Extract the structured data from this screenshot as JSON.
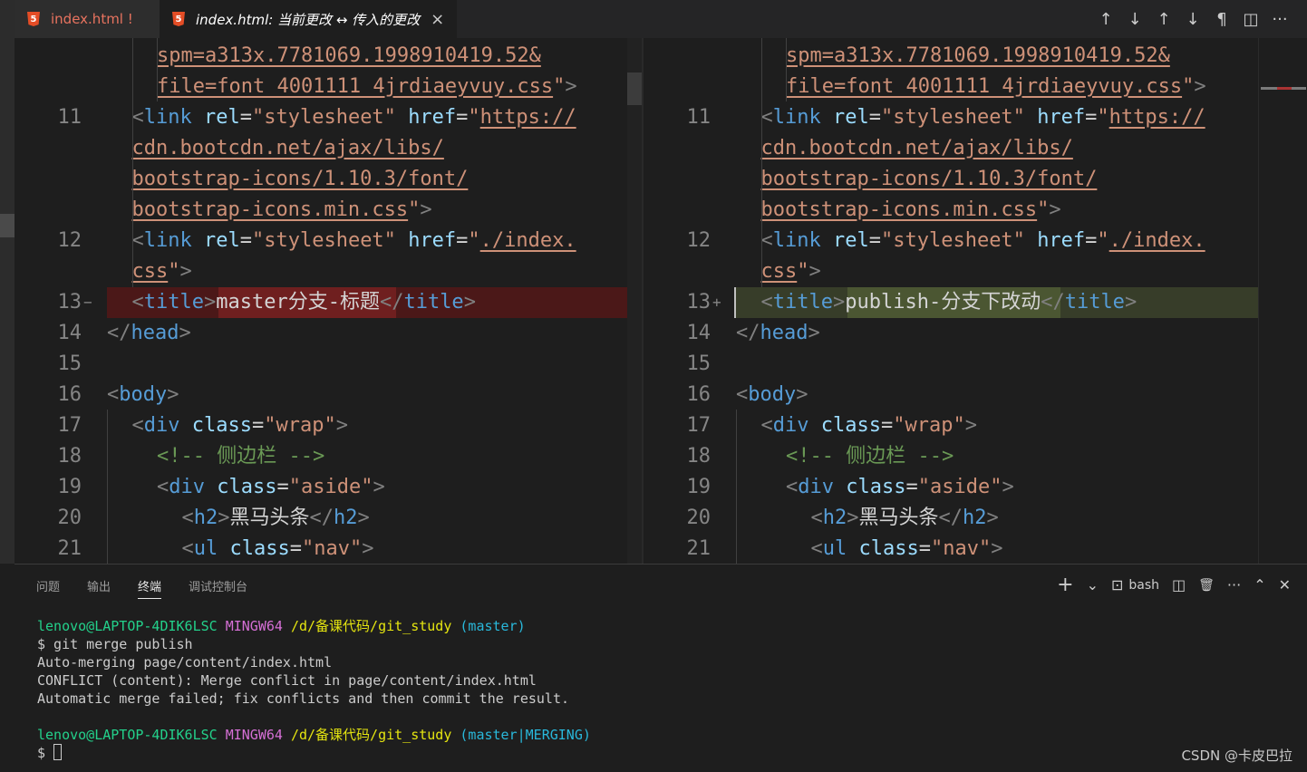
{
  "tabs": [
    {
      "label": "index.html !",
      "active": false
    },
    {
      "label": "index.html: 当前更改 ↔ 传入的更改",
      "active": true
    }
  ],
  "tab_actions": [
    "↑",
    "↓",
    "↑",
    "↓",
    "¶",
    "◫",
    "···"
  ],
  "editor": {
    "left": {
      "conflict_marker": "−",
      "lines": [
        {
          "num": "",
          "text": "spm=a313x.7781069.1998910419.52&"
        },
        {
          "num": "",
          "text": "file=font_4001111_4jrdiaeyvuy.css\">"
        },
        {
          "num": "11",
          "text": "<link rel=\"stylesheet\" href=\"https://"
        },
        {
          "num": "",
          "text": "cdn.bootcdn.net/ajax/libs/"
        },
        {
          "num": "",
          "text": "bootstrap-icons/1.10.3/font/"
        },
        {
          "num": "",
          "text": "bootstrap-icons.min.css\">"
        },
        {
          "num": "12",
          "text": "<link rel=\"stylesheet\" href=\"./index."
        },
        {
          "num": "",
          "text": "css\">"
        },
        {
          "num": "13",
          "text": "<title>master分支-标题</title>"
        },
        {
          "num": "14",
          "text": "</head>"
        },
        {
          "num": "15",
          "text": ""
        },
        {
          "num": "16",
          "text": "<body>"
        },
        {
          "num": "17",
          "text": "<div class=\"wrap\">"
        },
        {
          "num": "18",
          "text": "<!-- 侧边栏 -->"
        },
        {
          "num": "19",
          "text": "<div class=\"aside\">"
        },
        {
          "num": "20",
          "text": "<h2>黑马头条</h2>"
        },
        {
          "num": "21",
          "text": "<ul class=\"nav\">"
        }
      ]
    },
    "right": {
      "conflict_marker": "+",
      "lines": [
        {
          "num": "",
          "text": "spm=a313x.7781069.1998910419.52&"
        },
        {
          "num": "",
          "text": "file=font_4001111_4jrdiaeyvuy.css\">"
        },
        {
          "num": "11",
          "text": "<link rel=\"stylesheet\" href=\"https://"
        },
        {
          "num": "",
          "text": "cdn.bootcdn.net/ajax/libs/"
        },
        {
          "num": "",
          "text": "bootstrap-icons/1.10.3/font/"
        },
        {
          "num": "",
          "text": "bootstrap-icons.min.css\">"
        },
        {
          "num": "12",
          "text": "<link rel=\"stylesheet\" href=\"./index."
        },
        {
          "num": "",
          "text": "css\">"
        },
        {
          "num": "13",
          "text": "<title>publish-分支下改动</title>"
        },
        {
          "num": "14",
          "text": "</head>"
        },
        {
          "num": "15",
          "text": ""
        },
        {
          "num": "16",
          "text": "<body>"
        },
        {
          "num": "17",
          "text": "<div class=\"wrap\">"
        },
        {
          "num": "18",
          "text": "<!-- 侧边栏 -->"
        },
        {
          "num": "19",
          "text": "<div class=\"aside\">"
        },
        {
          "num": "20",
          "text": "<h2>黑马头条</h2>"
        },
        {
          "num": "21",
          "text": "<ul class=\"nav\">"
        }
      ]
    }
  },
  "panel": {
    "tabs": [
      {
        "label": "问题",
        "active": false
      },
      {
        "label": "输出",
        "active": false
      },
      {
        "label": "终端",
        "active": true
      },
      {
        "label": "调试控制台",
        "active": false
      }
    ],
    "actions": {
      "new": "+",
      "dropdown": "⌄",
      "shell_icon": "⊡",
      "shell": "bash",
      "split": "◫",
      "trash": "🗑",
      "more": "···",
      "maximize": "⌃",
      "close": "✕"
    }
  },
  "terminal": {
    "prompt1": {
      "user": "lenovo@LAPTOP-4DIK6LSC",
      "sys": "MINGW64",
      "path": "/d/备课代码/git_study",
      "branch": "(master)"
    },
    "command": "$ git merge publish",
    "output": [
      "Auto-merging page/content/index.html",
      "CONFLICT (content): Merge conflict in page/content/index.html",
      "Automatic merge failed; fix conflicts and then commit the result."
    ],
    "prompt2": {
      "user": "lenovo@LAPTOP-4DIK6LSC",
      "sys": "MINGW64",
      "path": "/d/备课代码/git_study",
      "branch": "(master|MERGING)"
    },
    "input_prompt": "$"
  },
  "watermark": "CSDN @卡皮巴拉"
}
